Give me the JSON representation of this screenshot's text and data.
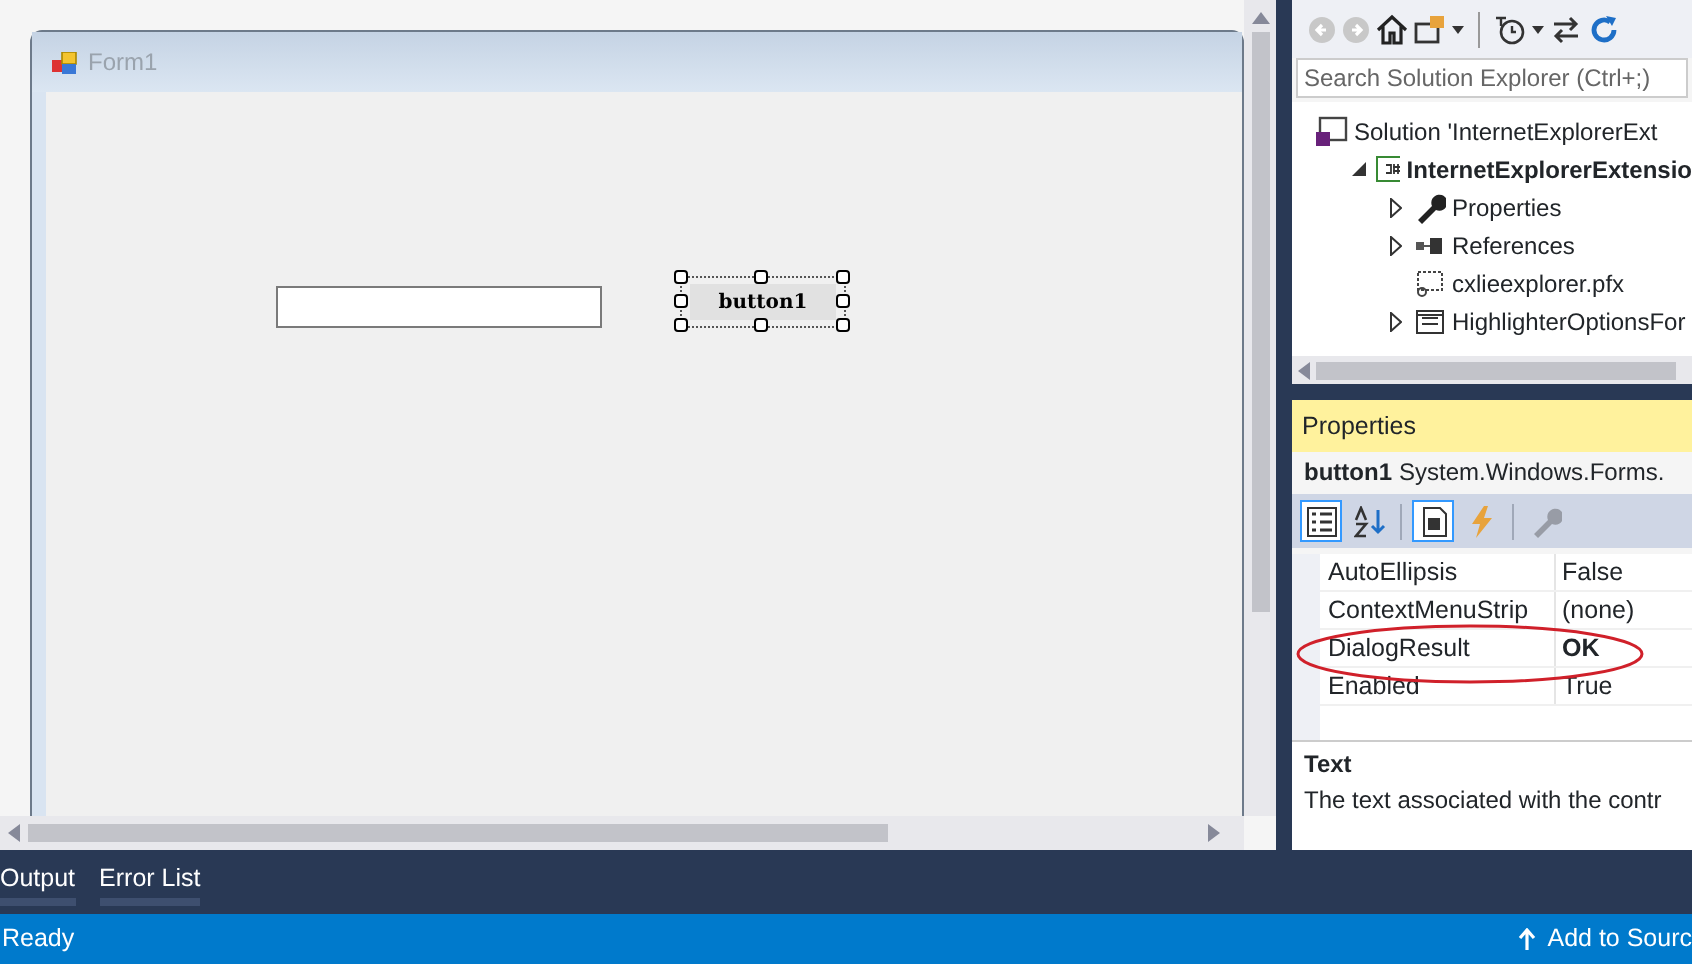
{
  "designer": {
    "form": {
      "title": "Form1"
    },
    "button": {
      "label": "button1",
      "selected": true
    }
  },
  "solution_explorer": {
    "search": {
      "placeholder": "Search Solution Explorer (Ctrl+;)"
    },
    "tree": [
      {
        "label": "Solution 'InternetExplorerExt",
        "kind": "solution",
        "toggle": false,
        "bold": false,
        "children": [
          {
            "label": "InternetExplorerExtensio",
            "kind": "csharp-project",
            "toggle": true,
            "expanded": true,
            "bold": true,
            "children": [
              {
                "label": "Properties",
                "kind": "wrench",
                "toggle": true,
                "expanded": false,
                "bold": false
              },
              {
                "label": "References",
                "kind": "references",
                "toggle": true,
                "expanded": false,
                "bold": false
              },
              {
                "label": "cxlieexplorer.pfx",
                "kind": "certificate",
                "toggle": false,
                "bold": false
              },
              {
                "label": "HighlighterOptionsFor",
                "kind": "form",
                "toggle": true,
                "expanded": false,
                "bold": false
              }
            ]
          }
        ]
      }
    ]
  },
  "properties": {
    "title": "Properties",
    "object_name": "button1",
    "object_type": "System.Windows.Forms.",
    "toolbar": [
      {
        "kind": "categorized",
        "selected": true,
        "disabled": false
      },
      {
        "kind": "alphabetical",
        "selected": false,
        "disabled": false
      },
      {
        "kind": "property-view",
        "selected": true,
        "disabled": false
      },
      {
        "kind": "events",
        "selected": false,
        "disabled": false
      },
      {
        "kind": "wrench",
        "selected": false,
        "disabled": true
      }
    ],
    "rows": [
      {
        "name": "AutoEllipsis",
        "value": "False",
        "bold": false,
        "circled": false
      },
      {
        "name": "ContextMenuStrip",
        "value": "(none)",
        "bold": false,
        "circled": false
      },
      {
        "name": "DialogResult",
        "value": "OK",
        "bold": true,
        "circled": true
      },
      {
        "name": "Enabled",
        "value": "True",
        "bold": false,
        "circled": false
      }
    ],
    "description": {
      "title": "Text",
      "text": "The text associated with the contr"
    }
  },
  "bottom_tabs": [
    {
      "label": "Output",
      "selected": false
    },
    {
      "label": "Error List",
      "selected": false
    }
  ],
  "status_bar": {
    "text": "Ready",
    "action": "Add to Sourc"
  }
}
